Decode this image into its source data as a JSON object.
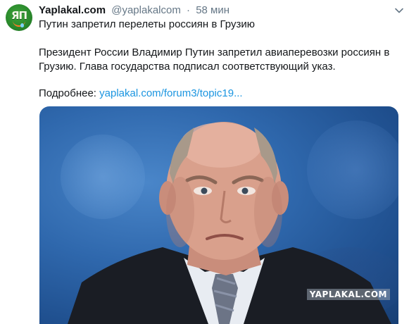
{
  "tweet": {
    "author_name": "Yaplakal.com",
    "author_handle": "@yaplakalcom",
    "separator": "·",
    "timestamp": "58 мин",
    "headline": "Путин запретил перелеты россиян в Грузию",
    "body": "Президент России Владимир Путин запретил авиаперевозки россиян в Грузию. Глава государства подписал соответствующий указ.",
    "more_label": "Подробнее:",
    "more_link": "yaplakal.com/forum3/topic19...",
    "avatar_text": "ЯП",
    "media_watermark": "YAPLAKAL.COM"
  },
  "colors": {
    "text": "#14171a",
    "muted": "#657786",
    "link": "#1b95e0",
    "avatar_green": "#2a8a2c",
    "media_bg": "#2f68ad"
  },
  "icons": {
    "more_menu": "chevron-down-icon"
  }
}
